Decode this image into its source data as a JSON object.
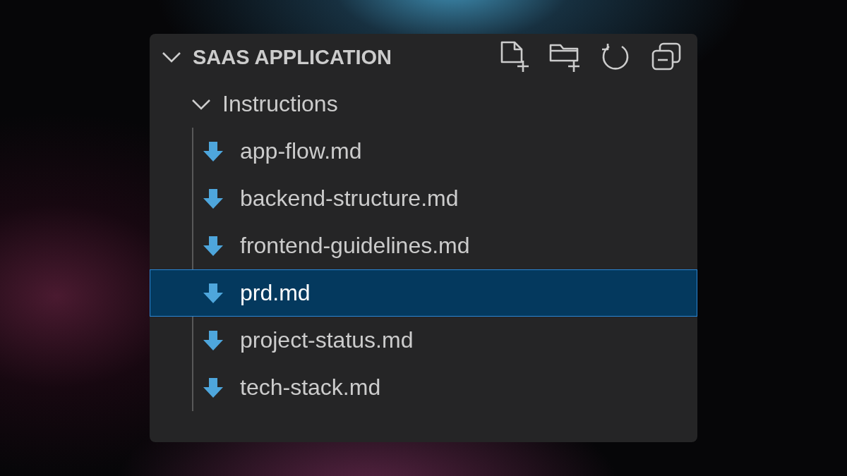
{
  "explorer": {
    "title": "SAAS APPLICATION",
    "expanded": true,
    "folders": [
      {
        "name": "Instructions",
        "expanded": true,
        "children": [
          {
            "name": "app-flow.md",
            "selected": false
          },
          {
            "name": "backend-structure.md",
            "selected": false
          },
          {
            "name": "frontend-guidelines.md",
            "selected": false
          },
          {
            "name": "prd.md",
            "selected": true
          },
          {
            "name": "project-status.md",
            "selected": false
          },
          {
            "name": "tech-stack.md",
            "selected": false
          }
        ]
      }
    ]
  }
}
